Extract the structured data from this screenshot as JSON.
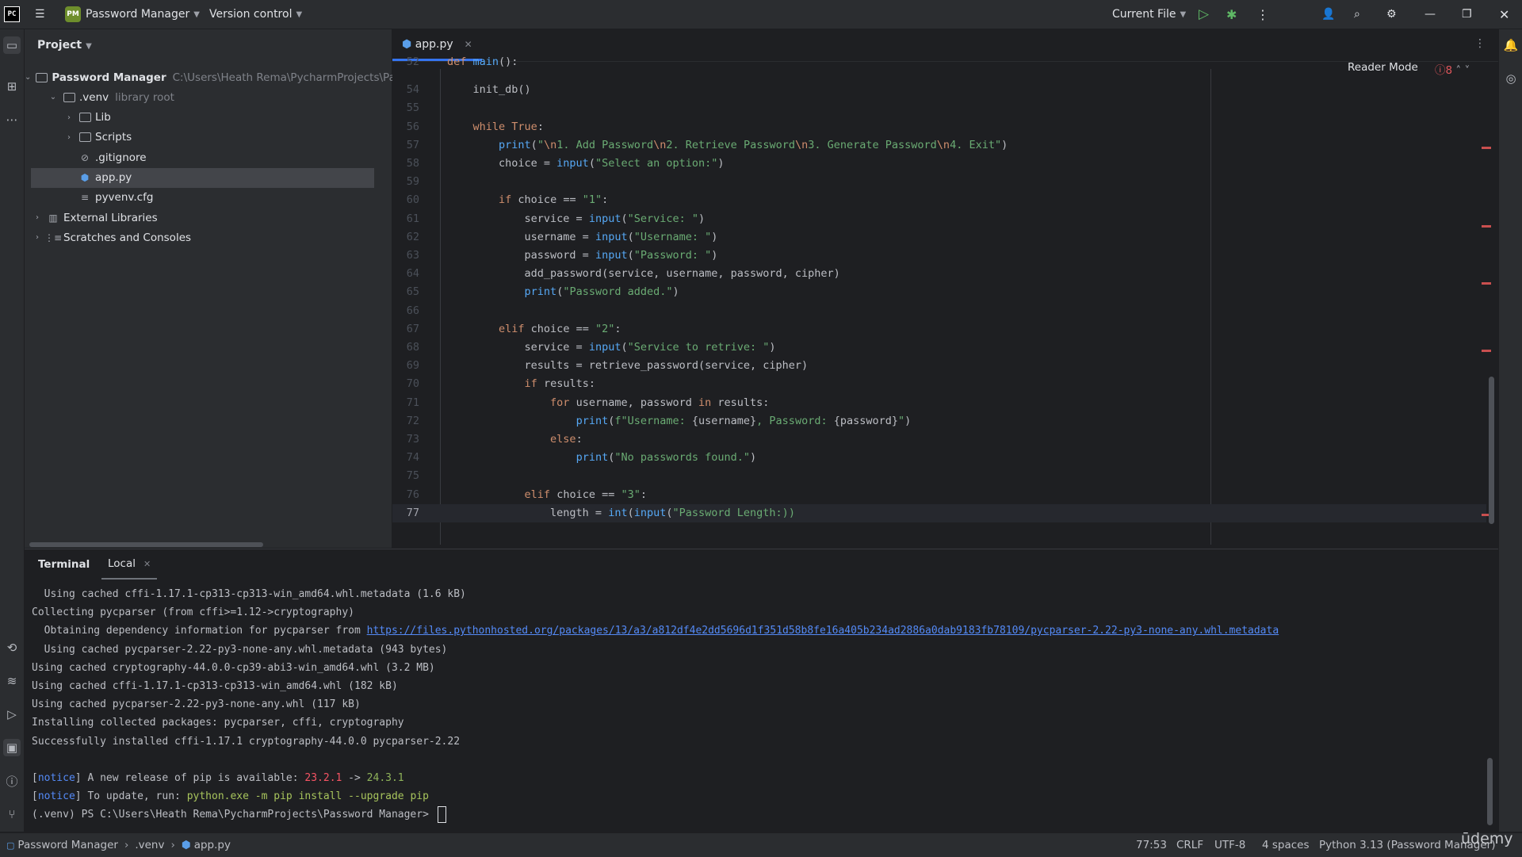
{
  "titlebar": {
    "app_logo": "PC",
    "project_badge": "PM",
    "project_name": "Password Manager",
    "vcs_label": "Version control",
    "run_config": "Current File",
    "icons": [
      "hamburger-menu-icon",
      "run-icon",
      "debug-icon",
      "more-vertical-icon",
      "add-user-icon",
      "search-icon",
      "settings-icon",
      "minimize-icon",
      "maximize-icon",
      "close-icon"
    ]
  },
  "project_panel": {
    "title": "Project",
    "tree": [
      {
        "label": "Password Manager",
        "sub": "C:\\Users\\Heath Rema\\PycharmProjects\\Pass",
        "depth": 0,
        "expanded": true,
        "kind": "folder"
      },
      {
        "label": ".venv",
        "sub": "library root",
        "depth": 1,
        "expanded": true,
        "kind": "folder"
      },
      {
        "label": "Lib",
        "sub": "",
        "depth": 2,
        "expanded": false,
        "kind": "folder"
      },
      {
        "label": "Scripts",
        "sub": "",
        "depth": 2,
        "expanded": false,
        "kind": "folder"
      },
      {
        "label": ".gitignore",
        "sub": "",
        "depth": 2,
        "kind": "ignore"
      },
      {
        "label": "app.py",
        "sub": "",
        "depth": 2,
        "kind": "python",
        "selected": true
      },
      {
        "label": "pyvenv.cfg",
        "sub": "",
        "depth": 2,
        "kind": "config"
      },
      {
        "label": "External Libraries",
        "sub": "",
        "depth": 0,
        "expanded": false,
        "kind": "library"
      },
      {
        "label": "Scratches and Consoles",
        "sub": "",
        "depth": 0,
        "expanded": false,
        "kind": "scratch"
      }
    ]
  },
  "editor": {
    "tab_label": "app.py",
    "reader_mode": "Reader Mode",
    "error_count": "8",
    "lines": [
      {
        "n": "52",
        "html": "<span class='kw'>def</span> <span class='fn'>main</span>():"
      },
      {
        "n": "54",
        "html": "    init_db()"
      },
      {
        "n": "55",
        "html": ""
      },
      {
        "n": "56",
        "html": "    <span class='kw'>while</span> <span class='kw'>True</span>:"
      },
      {
        "n": "57",
        "html": "        <span class='fn'>print</span>(<span class='str'>\"<span class='esc'>\\n</span>1. Add Password<span class='esc'>\\n</span>2. Retrieve Password<span class='esc'>\\n</span>3. Generate Password<span class='esc'>\\n</span>4. Exit\"</span>)"
      },
      {
        "n": "58",
        "html": "        choice = <span class='fn'>input</span>(<span class='str'>\"Select an option:\"</span>)"
      },
      {
        "n": "59",
        "html": ""
      },
      {
        "n": "60",
        "html": "        <span class='kw'>if</span> choice == <span class='str'>\"1\"</span>:"
      },
      {
        "n": "61",
        "html": "            service = <span class='fn'>input</span>(<span class='str'>\"Service: \"</span>)"
      },
      {
        "n": "62",
        "html": "            username = <span class='fn'>input</span>(<span class='str'>\"Username: \"</span>)"
      },
      {
        "n": "63",
        "html": "            password = <span class='fn'>input</span>(<span class='str'>\"Password: \"</span>)"
      },
      {
        "n": "64",
        "html": "            add_password(service, username, password, cipher)"
      },
      {
        "n": "65",
        "html": "            <span class='fn'>print</span>(<span class='str'>\"Password added.\"</span>)"
      },
      {
        "n": "66",
        "html": ""
      },
      {
        "n": "67",
        "html": "        <span class='kw'>elif</span> choice == <span class='str'>\"2\"</span>:"
      },
      {
        "n": "68",
        "html": "            service = <span class='fn'>input</span>(<span class='str'>\"Service to retrive: \"</span>)"
      },
      {
        "n": "69",
        "html": "            results = retrieve_password(service, cipher)"
      },
      {
        "n": "70",
        "html": "            <span class='kw'>if</span> results:"
      },
      {
        "n": "71",
        "html": "                <span class='kw'>for</span> username, password <span class='kw'>in</span> results:"
      },
      {
        "n": "72",
        "html": "                    <span class='fn'>print</span>(<span class='str'>f\"Username: </span>{username}<span class='str'>, Password: </span>{password}<span class='str'>\"</span>)"
      },
      {
        "n": "73",
        "html": "                <span class='kw'>else</span>:"
      },
      {
        "n": "74",
        "html": "                    <span class='fn'>print</span>(<span class='str'>\"No passwords found.\"</span>)"
      },
      {
        "n": "75",
        "html": ""
      },
      {
        "n": "76",
        "html": "            <span class='kw'>elif</span> choice == <span class='str'>\"3\"</span>:"
      },
      {
        "n": "77",
        "html": "                length = <span class='fn'>int</span>(<span class='fn'>input</span>(<span class='str'>\"Password Length:))</span>",
        "current": true
      }
    ]
  },
  "terminal": {
    "tab_terminal": "Terminal",
    "tab_local": "Local",
    "lines": [
      {
        "html": "  Using cached cffi-1.17.1-cp313-cp313-win_amd64.whl.metadata (1.6 kB)"
      },
      {
        "html": "Collecting pycparser (from cffi>=1.12->cryptography)"
      },
      {
        "html": "  Obtaining dependency information for pycparser from <span class='link'>https://files.pythonhosted.org/packages/13/a3/a812df4e2dd5696d1f351d58b8fe16a405b234ad2886a0dab9183fb78109/pycparser-2.22-py3-none-any.whl.metadata</span>"
      },
      {
        "html": "  Using cached pycparser-2.22-py3-none-any.whl.metadata (943 bytes)"
      },
      {
        "html": "Using cached cryptography-44.0.0-cp39-abi3-win_amd64.whl (3.2 MB)"
      },
      {
        "html": "Using cached cffi-1.17.1-cp313-cp313-win_amd64.whl (182 kB)"
      },
      {
        "html": "Using cached pycparser-2.22-py3-none-any.whl (117 kB)"
      },
      {
        "html": "Installing collected packages: pycparser, cffi, cryptography"
      },
      {
        "html": "Successfully installed cffi-1.17.1 cryptography-44.0.0 pycparser-2.22"
      },
      {
        "html": ""
      },
      {
        "html": "[<span class='notice'>notice</span>] A new release of pip is available: <span class='red'>23.2.1</span> -> <span class='green'>24.3.1</span>"
      },
      {
        "html": "[<span class='notice'>notice</span>] To update, run: <span class='olive'>python.exe -m pip install --upgrade pip</span>"
      },
      {
        "html": "(.venv) PS C:\\Users\\Heath Rema\\PycharmProjects\\Password Manager> <span class='caret'></span>"
      }
    ]
  },
  "statusbar": {
    "crumb_project": "Password Manager",
    "crumb_venv": ".venv",
    "crumb_file": "app.py",
    "position": "77:53",
    "line_sep": "CRLF",
    "encoding": "UTF-8",
    "indent": "4 spaces",
    "interpreter": "Python 3.13 (Password Manager)"
  },
  "watermark": "ūdemy"
}
